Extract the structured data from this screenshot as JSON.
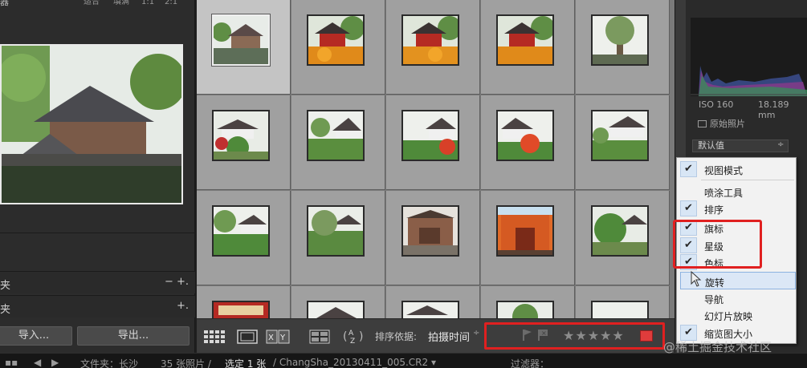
{
  "left_panel": {
    "nav_title": "器",
    "zoom_options": [
      "适合",
      "填满",
      "1:1",
      "2:1"
    ],
    "folders_label": "夹",
    "folders_controls": "− +.",
    "collections_label": "夹",
    "collections_controls": "+.",
    "import_label": "导入...",
    "export_label": "导出..."
  },
  "grid": {
    "rows": 4,
    "cols": 5,
    "selected_index": 0
  },
  "toolbar": {
    "sort_label": "排序依据:",
    "sort_value": "拍摄时间",
    "sort_arrow": "÷",
    "stars": "★★★★★"
  },
  "right_panel": {
    "iso": "ISO 160",
    "focal": "18.189 mm",
    "original_photo_label": "原始照片",
    "preset_value": "默认值",
    "preset_arrow": "÷"
  },
  "context_menu": {
    "items": [
      {
        "label": "视图模式",
        "checked": true
      },
      {
        "label": "喷涂工具",
        "checked": false
      },
      {
        "label": "排序",
        "checked": true
      },
      {
        "label": "旗标",
        "checked": true
      },
      {
        "label": "星级",
        "checked": true
      },
      {
        "label": "色标",
        "checked": true
      },
      {
        "label": "旋转",
        "checked": false
      },
      {
        "label": "导航",
        "checked": false
      },
      {
        "label": "幻灯片放映",
        "checked": false
      },
      {
        "label": "缩览图大小",
        "checked": true
      }
    ]
  },
  "status_bar": {
    "path": "文件夹：长沙",
    "count": "35 张照片 /",
    "selected": "选定 1 张",
    "filename": "/ ChangSha_20130411_005.CR2 ▾",
    "filter_label": "过滤器："
  },
  "watermark": "@稀土掘金技术社区",
  "colors": {
    "accent_red": "#e02020",
    "grid_bg": "#7a7a7a",
    "menu_hover": "#dbe7f6"
  }
}
